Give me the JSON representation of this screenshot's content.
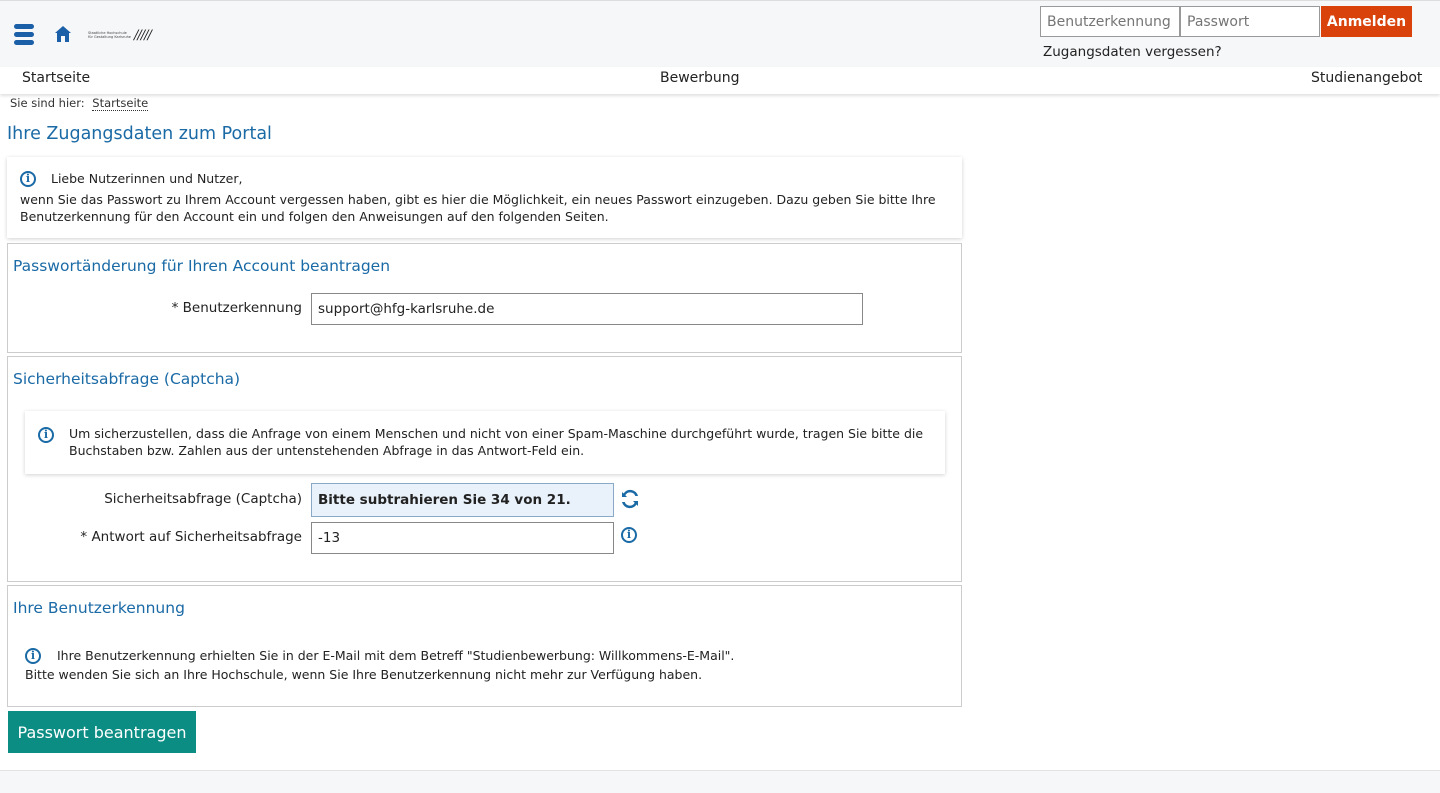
{
  "header": {
    "logo_line1": "Staatliche Hochschule",
    "logo_line2": "für Gestaltung Karlsruhe",
    "logo_marks": "/////",
    "login_user_placeholder": "Benutzerkennung",
    "login_pass_placeholder": "Passwort",
    "login_button": "Anmelden",
    "forgot_link": "Zugangsdaten vergessen?"
  },
  "nav": {
    "items": [
      "Startseite",
      "Bewerbung",
      "Studienangebot"
    ]
  },
  "breadcrumb": {
    "prefix": "Sie sind hier:",
    "link": "Startseite"
  },
  "page_title": "Ihre Zugangsdaten zum Portal",
  "intro": {
    "greeting": "Liebe Nutzerinnen und Nutzer,",
    "text": "wenn Sie das Passwort zu Ihrem Account vergessen haben, gibt es hier die Möglichkeit, ein neues Passwort einzugeben. Dazu geben Sie bitte Ihre Benutzerkennung für den Account ein und folgen den Anweisungen auf den folgenden Seiten."
  },
  "password_section": {
    "title": "Passwortänderung für Ihren Account beantragen",
    "username_label": "* Benutzerkennung",
    "username_value": "support@hfg-karlsruhe.de"
  },
  "captcha_section": {
    "title": "Sicherheitsabfrage (Captcha)",
    "info": "Um sicherzustellen, dass die Anfrage von einem Menschen und nicht von einer Spam-Maschine durchgeführt wurde, tragen Sie bitte die Buchstaben bzw. Zahlen aus der untenstehenden Abfrage in das Antwort-Feld ein.",
    "captcha_label": "Sicherheitsabfrage (Captcha)",
    "captcha_question": "Bitte subtrahieren Sie 34 von 21.",
    "answer_label": "* Antwort auf Sicherheitsabfrage",
    "answer_value": "-13"
  },
  "username_section": {
    "title": "Ihre Benutzerkennung",
    "line1": "Ihre Benutzerkennung erhielten Sie in der E-Mail mit dem Betreff \"Studienbewerbung: Willkommens-E-Mail\".",
    "line2": "Bitte wenden Sie sich an Ihre Hochschule, wenn Sie Ihre Benutzerkennung nicht mehr zur Verfügung haben."
  },
  "submit_button": "Passwort beantragen",
  "colors": {
    "accent_blue": "#1a6aa6",
    "login_orange": "#d9420b",
    "submit_teal": "#0c8d84"
  }
}
